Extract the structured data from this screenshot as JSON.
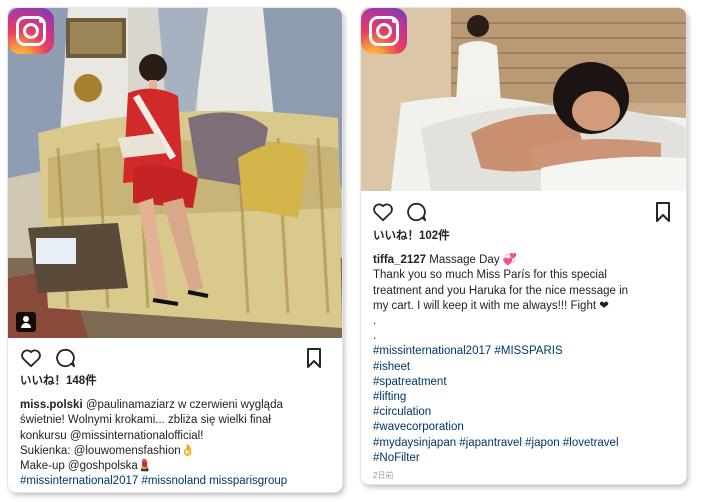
{
  "posts": [
    {
      "likes": "いいね！148件",
      "caption_lines": [
        {
          "user": "miss.polski",
          "text": " @paulinamaziarz w czerwieni wygląda"
        },
        {
          "text": "świetnie! Wolnymi krokami... zbliża się wielki finał"
        },
        {
          "text": "konkursu @missinternationalofficial!"
        },
        {
          "text": "Sukienka: @louwomensfashion",
          "emoji": "👌"
        },
        {
          "text": "Make-up @goshpolska",
          "emoji": "💄"
        },
        {
          "text": "#missinternational2017 #missnoland missparisgroup"
        }
      ]
    },
    {
      "likes": "いいね！102件",
      "caption_lines": [
        {
          "user": "tiffa_2127",
          "text": " Massage Day",
          "emoji": "💞"
        },
        {
          "text": "Thank you so much Miss París for this special"
        },
        {
          "text": "treatment and you Haruka for the nice message in"
        },
        {
          "text": "my cart. I will keep it with me always!!! Fight",
          "emoji": "❤"
        },
        {
          "text": "."
        },
        {
          "text": "."
        },
        {
          "text": "#missinternational2017 #MISSPARIS",
          "tag": true
        },
        {
          "text": "#isheet",
          "tag": true
        },
        {
          "text": "#spatreatment",
          "tag": true
        },
        {
          "text": "#lifting",
          "tag": true
        },
        {
          "text": "#circulation",
          "tag": true
        },
        {
          "text": "#wavecorporation",
          "tag": true
        },
        {
          "text": "#mydaysinjapan #japantravel #japon #lovetravel",
          "tag": true
        },
        {
          "text": "#NoFilter",
          "tag": true
        }
      ],
      "timestamp": "2日前"
    }
  ],
  "icons": {
    "logo": "instagram-logo-icon",
    "like": "heart-icon",
    "comment": "comment-bubble-icon",
    "save": "bookmark-icon",
    "tagged": "user-tag-icon"
  },
  "colors": {
    "hashtag": "#003569",
    "text": "#222222",
    "timestamp": "#999999"
  }
}
